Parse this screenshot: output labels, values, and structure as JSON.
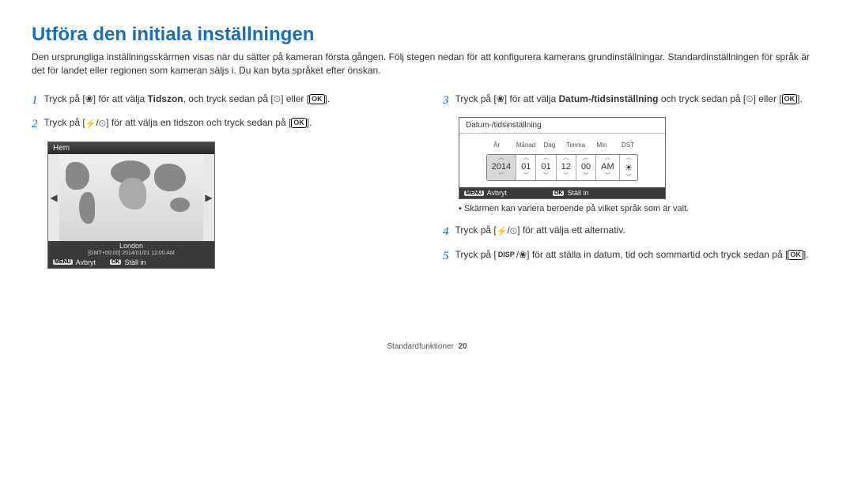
{
  "title": "Utföra den initiala inställningen",
  "intro": "Den ursprungliga inställningsskärmen visas när du sätter på kameran första gången. Följ stegen nedan för att konfigurera kamerans grundinställningar. Standardinställningen för språk är det för landet eller regionen som kameran säljs i. Du kan byta språket efter önskan.",
  "steps": {
    "s1a": "Tryck på [",
    "s1b": "] för att välja ",
    "s1bold": "Tidszon",
    "s1c": ", och tryck sedan på [",
    "s1d": "] eller [",
    "s1e": "].",
    "s2a": "Tryck på [",
    "s2b": "/",
    "s2c": "] för att välja en tidszon och tryck sedan på [",
    "s2d": "].",
    "s3a": "Tryck på [",
    "s3b": "] för att välja ",
    "s3bold": "Datum-/tidsinställning",
    "s3c": " och tryck sedan på [",
    "s3d": "] eller [",
    "s3e": "].",
    "s4a": "Tryck på [",
    "s4b": "/",
    "s4c": "] för att välja ett alternativ.",
    "s5a": "Tryck på [",
    "s5b": "/",
    "s5c": "] för att ställa in datum, tid och sommartid och tryck sedan på [",
    "s5d": "]."
  },
  "nums": {
    "n1": "1",
    "n2": "2",
    "n3": "3",
    "n4": "4",
    "n5": "5"
  },
  "ok_label": "OK",
  "disp_label": "DISP",
  "map": {
    "header": "Hem",
    "city": "London",
    "gmt": "[GMT+00:00] 2014/01/01 12:00 AM",
    "menu": "MENU",
    "cancel": "Avbryt",
    "ok": "OK",
    "set": "Ställ in"
  },
  "dt": {
    "header": "Datum-/tidsinställning",
    "labels": {
      "year": "År",
      "month": "Månad",
      "day": "Dag",
      "hour": "Timma",
      "min": "Min",
      "dst": "DST"
    },
    "values": {
      "year": "2014",
      "month": "01",
      "day": "01",
      "hour": "12",
      "min": "00",
      "ampm": "AM"
    },
    "menu": "MENU",
    "cancel": "Avbryt",
    "ok": "OK",
    "set": "Ställ in"
  },
  "note": "Skärmen kan variera beroende på vilket språk som är valt.",
  "footer": {
    "section": "Standardfunktioner",
    "page": "20"
  }
}
